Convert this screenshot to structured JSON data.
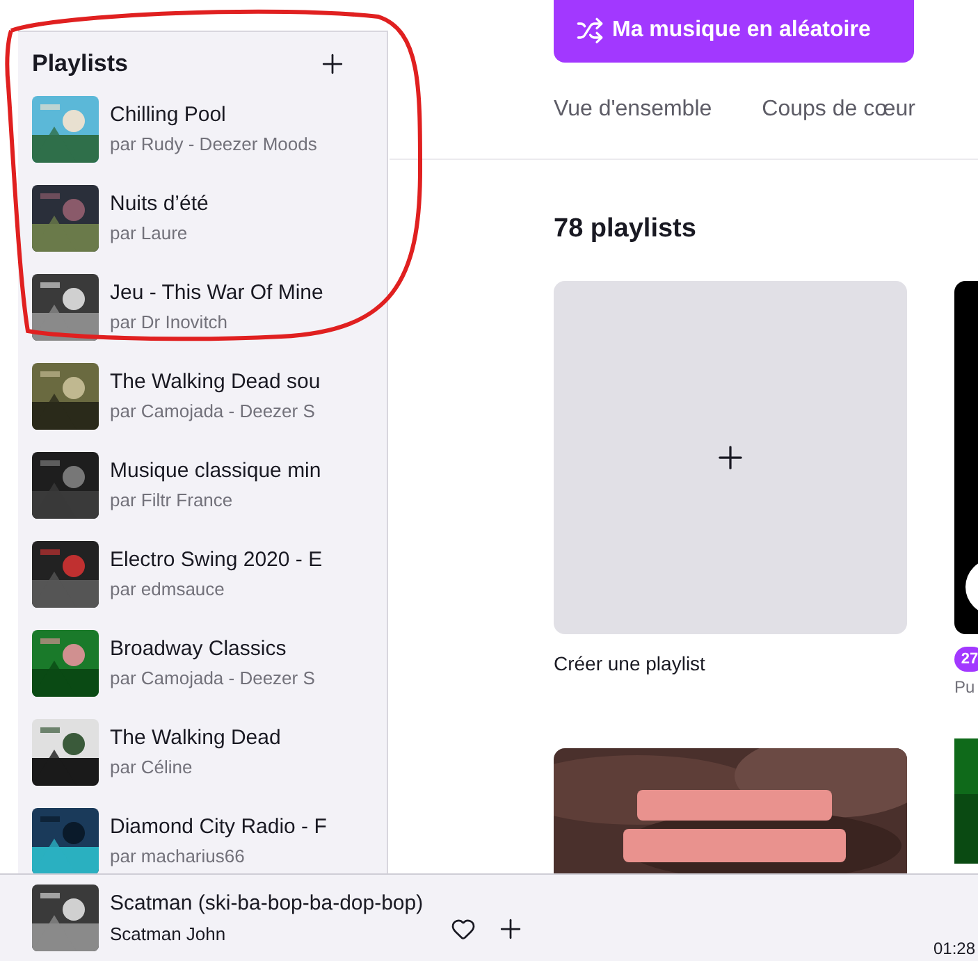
{
  "sidebar": {
    "title": "Playlists",
    "items": [
      {
        "title": "Chilling Pool",
        "subtitle": "par Rudy - Deezer Moods"
      },
      {
        "title": "Nuits d’été",
        "subtitle": "par Laure"
      },
      {
        "title": "Jeu - This War Of Mine",
        "subtitle": "par Dr Inovitch"
      },
      {
        "title": "The Walking Dead sou",
        "subtitle": "par Camojada - Deezer S"
      },
      {
        "title": "Musique classique min",
        "subtitle": "par Filtr France"
      },
      {
        "title": "Electro Swing 2020 - E",
        "subtitle": "par edmsauce"
      },
      {
        "title": "Broadway Classics",
        "subtitle": "par Camojada - Deezer S"
      },
      {
        "title": "The Walking Dead",
        "subtitle": "par Céline"
      },
      {
        "title": "Diamond City Radio - F",
        "subtitle": "par macharius66"
      }
    ]
  },
  "shuffle_button": {
    "label": "Ma musique en aléatoire"
  },
  "tabs": [
    {
      "label": "Vue d'ensemble",
      "selected": false
    },
    {
      "label": "Coups de cœur",
      "selected": false
    }
  ],
  "section_title": "78 playlists",
  "create_card": {
    "label": "Créer une playlist"
  },
  "partial_card": {
    "badge": "27",
    "caption": "Pu"
  },
  "player": {
    "title": "Scatman (ski-ba-bop-ba-dop-bop)",
    "artist": "Scatman John",
    "time": "01:28"
  }
}
